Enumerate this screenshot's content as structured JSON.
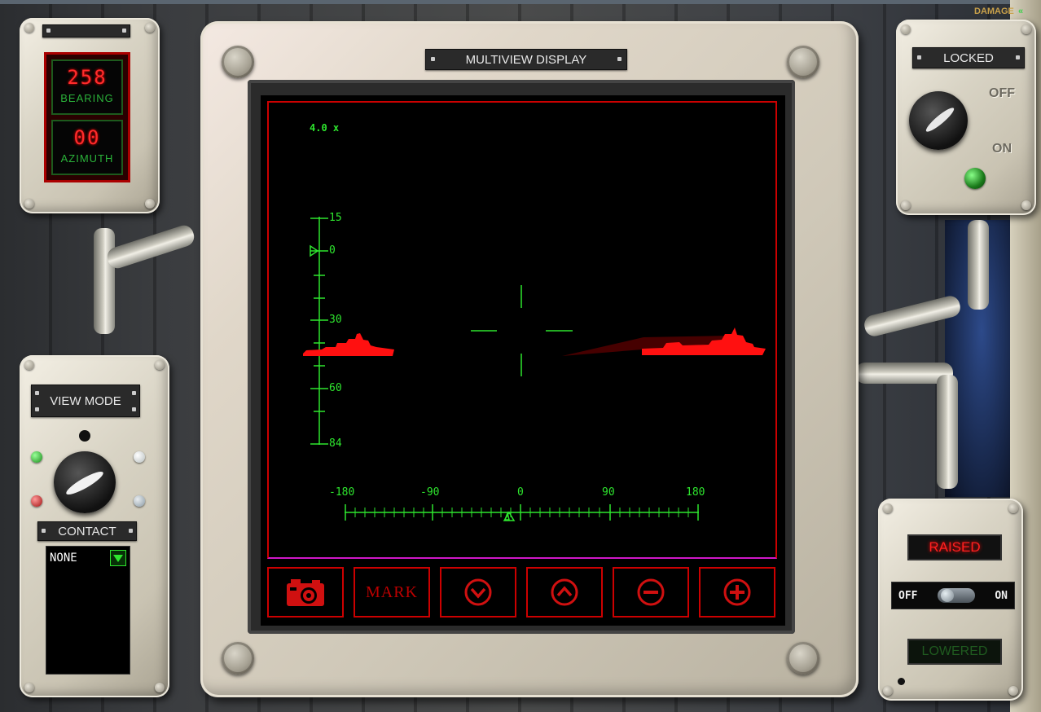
{
  "damage_label": "DAMAGE",
  "left_readout": {
    "bearing_value": "258",
    "bearing_label": "BEARING",
    "azimuth_value": "00",
    "azimuth_label": "AZIMUTH"
  },
  "view_mode": {
    "label": "VIEW MODE"
  },
  "contact": {
    "label": "CONTACT",
    "selected": "NONE"
  },
  "multiview": {
    "title": "MULTIVIEW DISPLAY",
    "zoom": "4.0 x",
    "elevation_ticks": [
      "15",
      "0",
      "30",
      "60",
      "84"
    ],
    "bearing_ticks": [
      "-180",
      "-90",
      "0",
      "90",
      "180"
    ],
    "buttons": {
      "camera_icon": "camera-icon",
      "mark_label": "MARK",
      "down_icon": "chevron-down-circle-icon",
      "up_icon": "chevron-up-circle-icon",
      "zoom_out_icon": "minus-circle-icon",
      "zoom_in_icon": "plus-circle-icon"
    }
  },
  "lock_panel": {
    "label": "LOCKED",
    "off_label": "OFF",
    "on_label": "ON"
  },
  "mast_panel": {
    "raised_label": "RAISED",
    "lowered_label": "LOWERED",
    "off_label": "OFF",
    "on_label": "ON"
  },
  "colors": {
    "scope_green": "#2ee62e",
    "scope_red": "#ff1010",
    "frame_red": "#c00000"
  }
}
